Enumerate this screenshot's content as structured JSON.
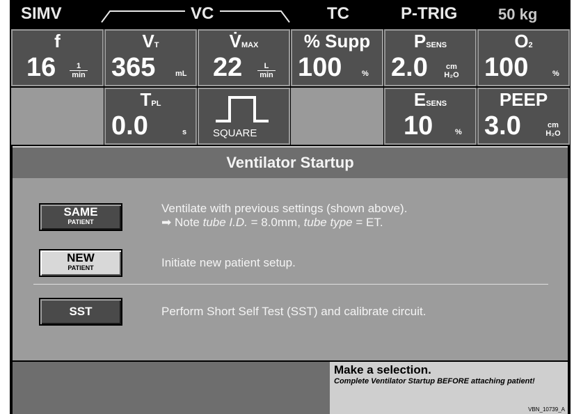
{
  "header": {
    "mode": "SIMV",
    "mandatory_type": "VC",
    "spont_type": "TC",
    "trigger": "P-TRIG",
    "weight": "50 kg"
  },
  "tiles_row1": [
    {
      "label": "f",
      "sub": "",
      "value": "16",
      "unit_num": "1",
      "unit_den": "min"
    },
    {
      "label": "V",
      "sub": "T",
      "value": "365",
      "unit": "mL"
    },
    {
      "label": "V̇",
      "sub": "MAX",
      "value": "22",
      "unit_num": "L",
      "unit_den": "min"
    },
    {
      "label": "% Supp",
      "sub": "",
      "value": "100",
      "unit": "%"
    },
    {
      "label": "P",
      "sub": "SENS",
      "value": "2.0",
      "unit_num": "cm",
      "unit_den": "H₂O"
    },
    {
      "label": "O",
      "sub": "2",
      "value": "100",
      "unit": "%"
    }
  ],
  "tiles_row2": [
    {
      "label": "T",
      "sub": "PL",
      "value": "0.0",
      "unit": "s"
    },
    {
      "label": "",
      "sub": "",
      "value": "SQUARE",
      "unit": ""
    },
    {
      "label": "E",
      "sub": "SENS",
      "value": "10",
      "unit": "%"
    },
    {
      "label": "PEEP",
      "sub": "",
      "value": "3.0",
      "unit_num": "cm",
      "unit_den": "H₂O"
    }
  ],
  "title": "Ventilator Startup",
  "options": {
    "same": {
      "label": "SAME",
      "sublabel": "PATIENT",
      "desc1": "Ventilate with previous settings (shown above).",
      "desc2_arrow": "➡ Note ",
      "desc2_i1": "tube I.D.",
      "desc2_v1": " = 8.0mm, ",
      "desc2_i2": "tube type",
      "desc2_v2": " = ET."
    },
    "new": {
      "label": "NEW",
      "sublabel": "PATIENT",
      "desc": "Initiate new patient setup."
    },
    "sst": {
      "label": "SST",
      "desc": "Perform Short Self Test (SST) and calibrate circuit."
    }
  },
  "footer": {
    "message": "Make a selection.",
    "warning": "Complete Ventilator Startup BEFORE attaching patient!",
    "code": "VBN_10739_A"
  },
  "colors": {
    "tile": "#505050",
    "panel": "#9c9c9c",
    "titlebar": "#6e6e6e",
    "message_bg": "#cfcfcf"
  }
}
